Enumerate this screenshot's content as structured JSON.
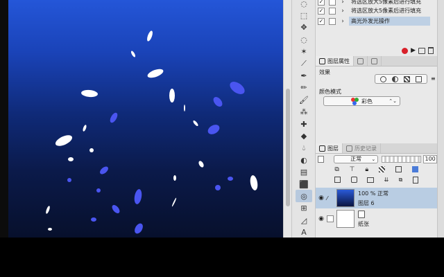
{
  "auto_actions": {
    "items": [
      {
        "label": "将选区放大5像素后进行填充",
        "checked": true,
        "selected": false
      },
      {
        "label": "将选区放大5像素后进行填充",
        "checked": true,
        "selected": false
      },
      {
        "label": "高光外发光操作",
        "checked": true,
        "selected": true
      }
    ]
  },
  "property_panel": {
    "tabs": [
      {
        "label": "图层属性",
        "icon": "layer-property-icon"
      },
      {
        "label": "",
        "icon": "sub-tool-icon"
      },
      {
        "label": "",
        "icon": "tool-property-icon"
      }
    ],
    "effect_label": "效果",
    "color_mode_label": "颜色模式",
    "color_mode_value": "彩色"
  },
  "layer_panel": {
    "tabs": [
      {
        "label": "图层",
        "icon": "layer-icon"
      },
      {
        "label": "历史记录",
        "icon": "history-icon"
      }
    ],
    "blend_mode": "正常",
    "opacity": "100",
    "layers": [
      {
        "line1": "100 % 正常",
        "line2": "图层 6",
        "selected": true,
        "thumb": "dark-blue"
      },
      {
        "line1": "",
        "line2": "纸张",
        "selected": false,
        "thumb": "white"
      }
    ]
  },
  "toolbar": {
    "tools": [
      "lasso-icon",
      "select-icon",
      "move-icon",
      "lasso-icon",
      "magic-wand-icon",
      "eyedropper-icon",
      "pen-icon",
      "pencil-icon",
      "brush-icon",
      "airbrush-icon",
      "decoration-icon",
      "eraser-icon",
      "blend-icon",
      "fill-icon",
      "gradient-icon",
      "figure-icon",
      "balloon-icon",
      "frame-icon",
      "ruler-icon",
      "text-icon"
    ],
    "active": "balloon-icon"
  },
  "colors": {
    "selection": "#b9cde3",
    "record": "#d8202a",
    "canvas_top": "#2456d8",
    "canvas_bottom": "#07102c",
    "flake_white": "#ffffff",
    "flake_blue": "#4a55f0"
  }
}
